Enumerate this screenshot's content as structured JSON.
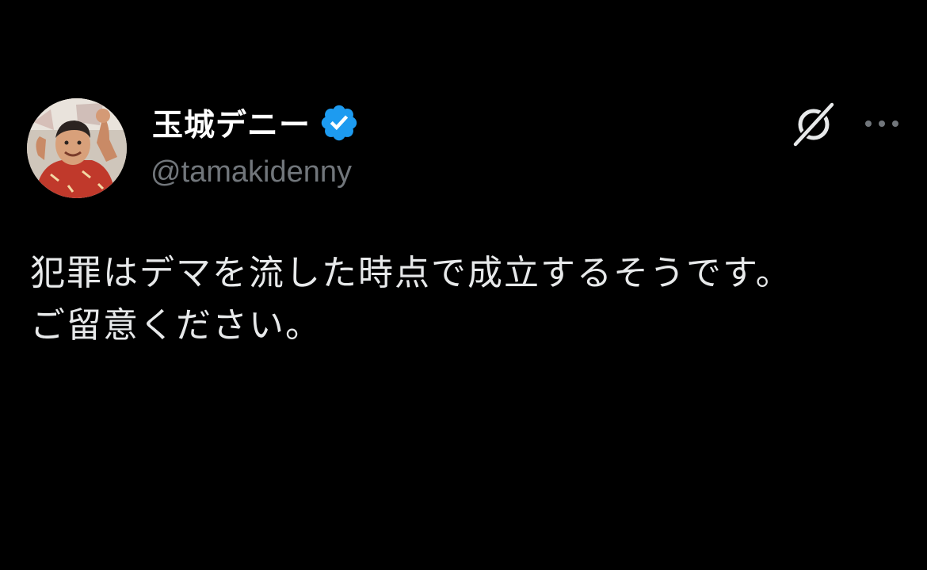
{
  "post": {
    "author": {
      "display_name": "玉城デニー",
      "handle": "@tamakidenny",
      "verified": true,
      "verified_color": "#1d9bf0",
      "avatar_icon": "profile-photo"
    },
    "text_lines": [
      "犯罪はデマを流した時点で成立するそうです。",
      "ご留意ください。"
    ],
    "actions": {
      "grok_icon": "grok-icon",
      "more_icon": "more-horizontal-icon"
    }
  },
  "theme": {
    "background": "#000000",
    "text": "#e7e9ea",
    "secondary_text": "#71767b"
  }
}
